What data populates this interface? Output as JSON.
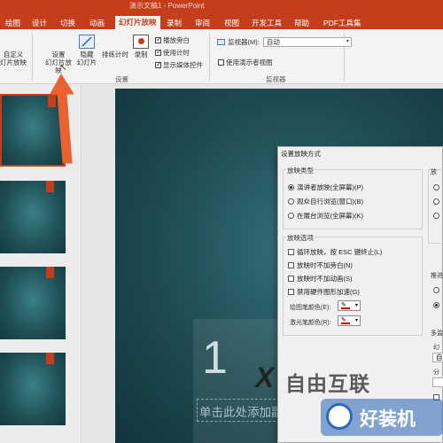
{
  "window": {
    "title": "演示文稿1 - PowerPoint"
  },
  "tabs": [
    "绘图",
    "设计",
    "切换",
    "动画",
    "幻灯片放映",
    "录制",
    "审阅",
    "视图",
    "开发工具",
    "帮助",
    "PDF工具集"
  ],
  "ribbon": {
    "custom_show": "自定义\n灯片放映",
    "setup_show": "设置\n幻灯片放映",
    "hide_slide": "隐藏\n幻灯片",
    "rehearse": "排练计时",
    "record": "录制",
    "checkboxes": [
      {
        "label": "播放旁白",
        "checked": true
      },
      {
        "label": "使用计时",
        "checked": true
      },
      {
        "label": "显示媒体控件",
        "checked": true
      }
    ],
    "group_setup": "设置",
    "monitor_label": "监视器(M):",
    "monitor_value": "自动",
    "presenter_view": "使用演示者视图",
    "group_monitors": "监视器"
  },
  "slide": {
    "number": "1",
    "subtitle_placeholder": "单击此处添加副标"
  },
  "dialog": {
    "title": "设置放映方式",
    "show_type_legend": "放映类型",
    "show_types": [
      {
        "label": "演讲者放映(全屏幕)(P)",
        "selected": true
      },
      {
        "label": "观众自行浏览(窗口)(B)",
        "selected": false
      },
      {
        "label": "在展台浏览(全屏幕)(K)",
        "selected": false
      }
    ],
    "options_legend": "放映选项",
    "options": [
      "循环放映，按 ESC 键终止(L)",
      "放映时不加旁白(N)",
      "放映时不加动画(S)",
      "禁用硬件图形加速(G)"
    ],
    "pen_color": "绘图笔颜色(E):",
    "laser_color": "激光笔颜色(R):",
    "right_fragments": [
      "放",
      "推进",
      "多监",
      "幻",
      "自",
      "分"
    ]
  },
  "watermark": {
    "brand": "自由互联",
    "badge": "好装机"
  },
  "colors": {
    "accent": "#c43e1c",
    "slide_bg": "#1d4a50"
  }
}
